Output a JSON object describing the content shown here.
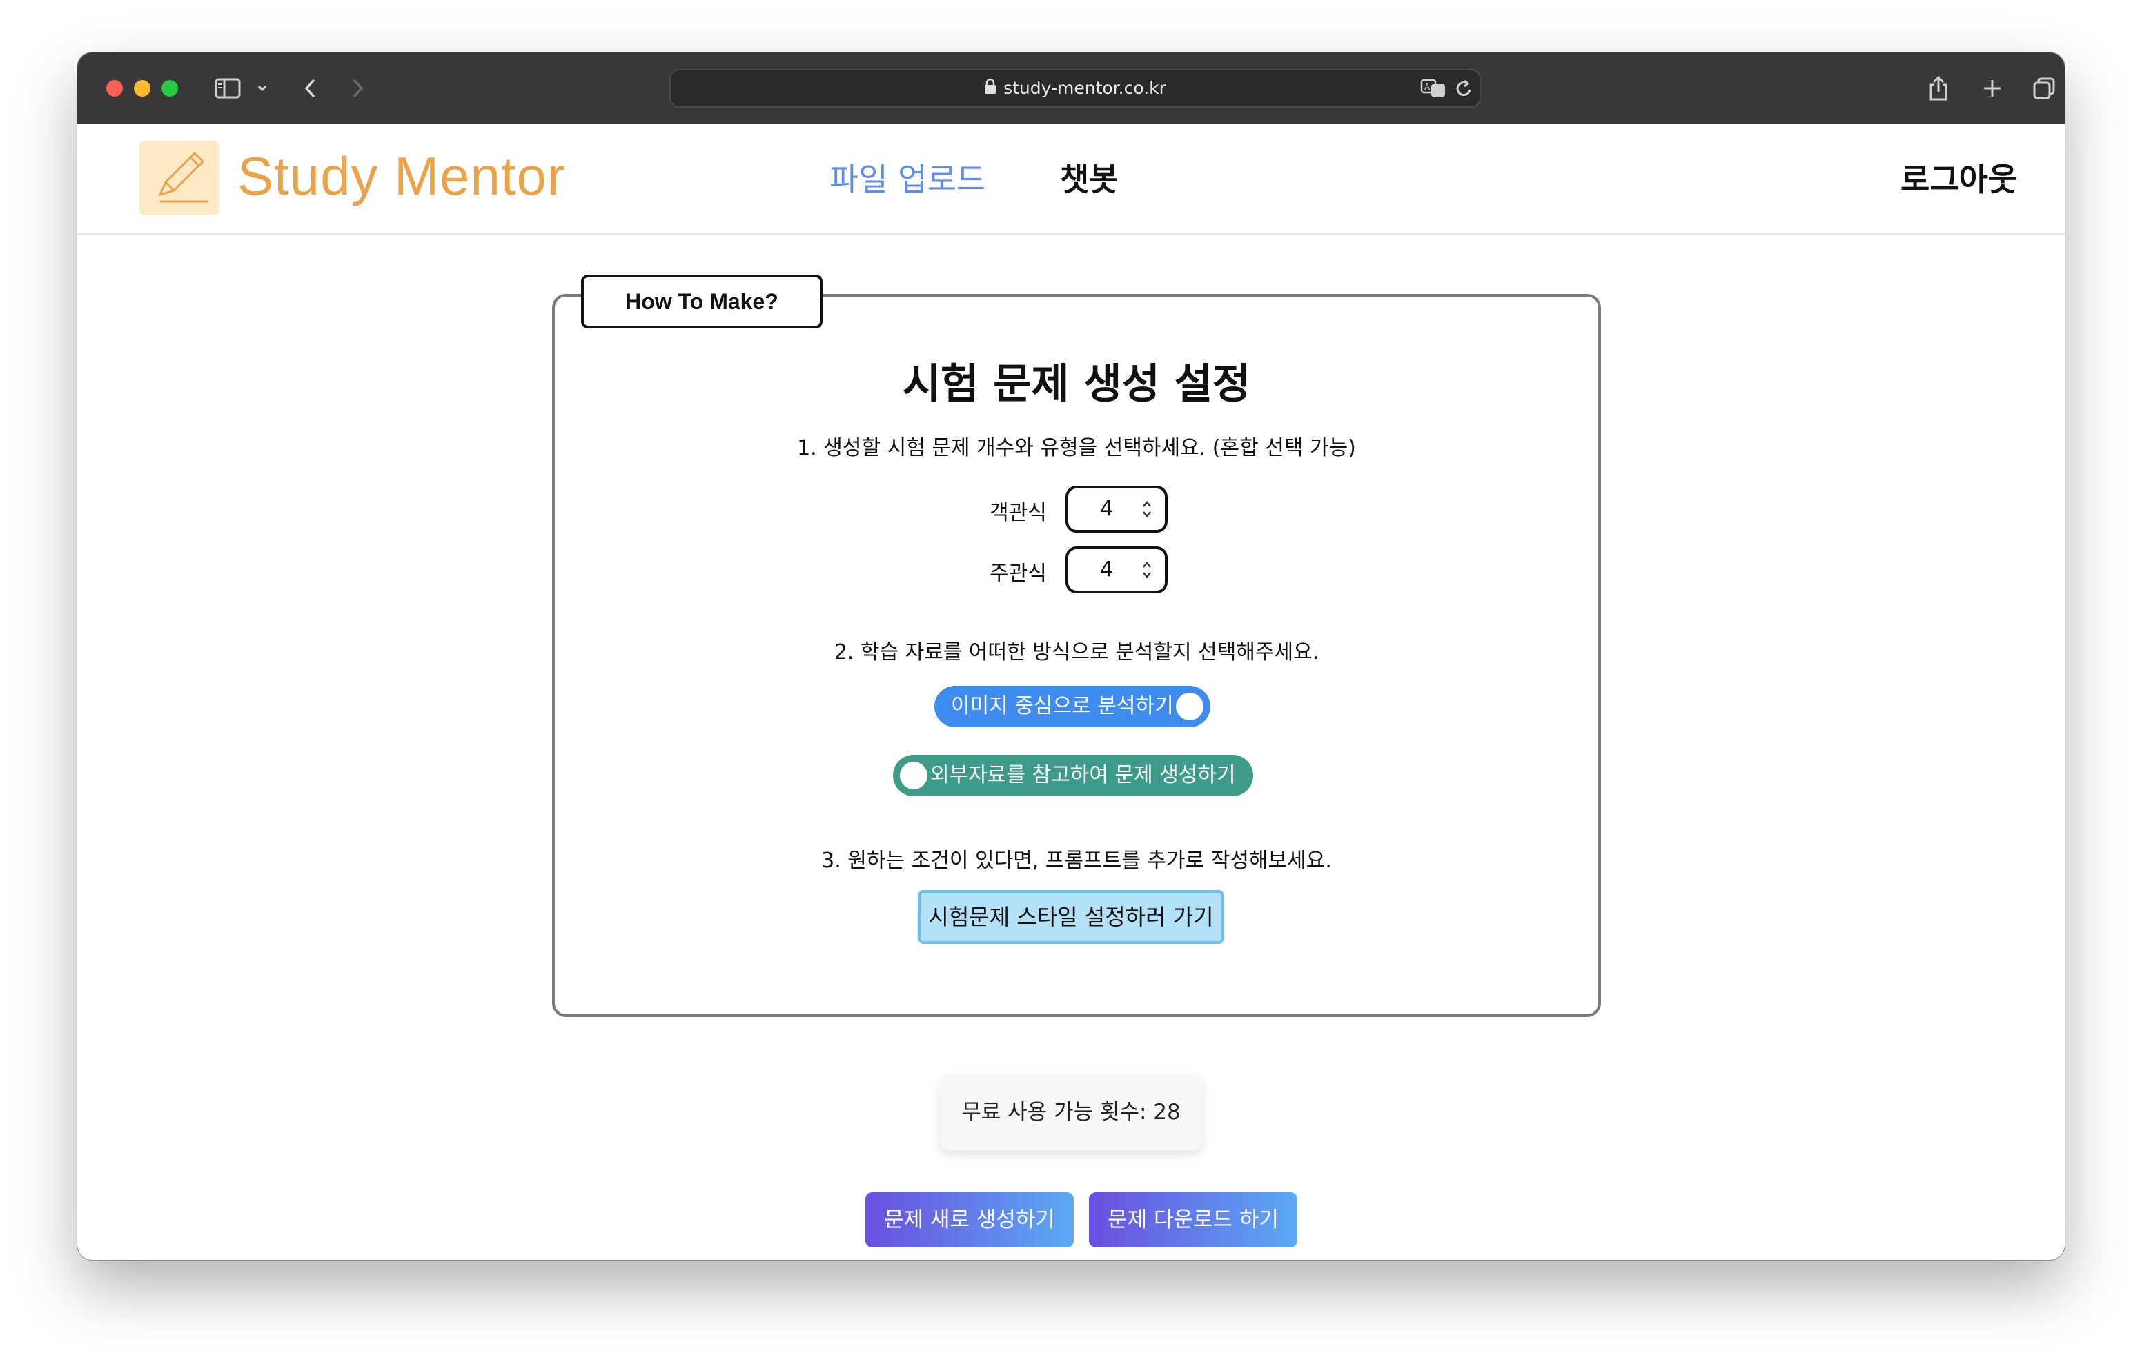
{
  "browser": {
    "url": "study-mentor.co.kr"
  },
  "header": {
    "logo_text": "Study Mentor",
    "nav_upload": "파일 업로드",
    "nav_chatbot": "챗봇",
    "logout": "로그아웃"
  },
  "card": {
    "tag": "How To Make?",
    "title": "시험 문제 생성 설정",
    "step1": "1. 생성할 시험 문제 개수와 유형을 선택하세요. (혼합 선택 가능)",
    "fields": [
      {
        "label": "객관식",
        "value": "4"
      },
      {
        "label": "주관식",
        "value": "4"
      }
    ],
    "step2": "2. 학습 자료를 어떠한 방식으로 분석할지 선택해주세요.",
    "toggle_image": {
      "label": "이미지 중심으로 분석하기",
      "color": "#3f8cf0"
    },
    "toggle_external": {
      "label": "외부자료를 참고하여 문제 생성하기",
      "color": "#3e9b8a"
    },
    "step3": "3. 원하는 조건이 있다면, 프롬프트를 추가로 작성해보세요.",
    "style_button": "시험문제 스타일 설정하러 가기"
  },
  "usage": {
    "text": "무료 사용 가능 횟수: 28"
  },
  "actions": {
    "regenerate": "문제 새로 생성하기",
    "download": "문제 다운로드 하기"
  },
  "colors": {
    "brand": "#eba34a",
    "nav_active": "#5f8de8"
  }
}
